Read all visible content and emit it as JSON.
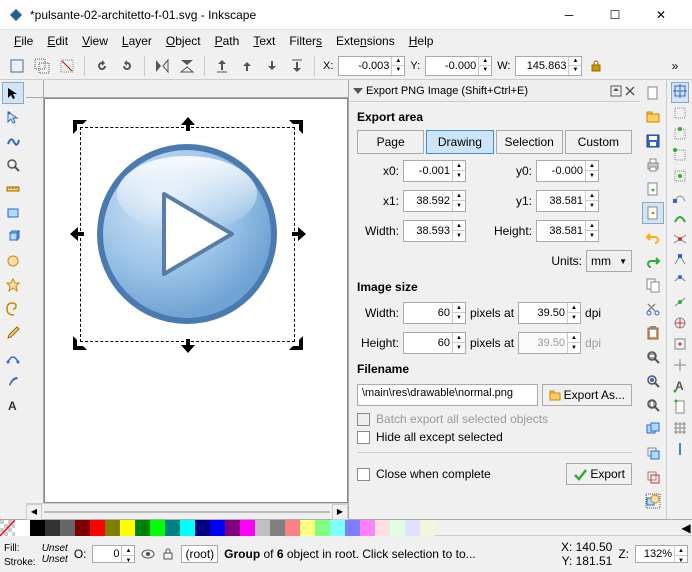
{
  "window": {
    "title": "*pulsante-02-architetto-f-01.svg - Inkscape"
  },
  "menu": {
    "file": "File",
    "edit": "Edit",
    "view": "View",
    "layer": "Layer",
    "object": "Object",
    "path": "Path",
    "text": "Text",
    "filters": "Filters",
    "extensions": "Extensions",
    "help": "Help"
  },
  "toolbar": {
    "x_label": "X:",
    "x_value": "-0.003",
    "y_label": "Y:",
    "y_value": "-0.000",
    "w_label": "W:",
    "w_value": "145.863"
  },
  "panel": {
    "title": "Export PNG Image (Shift+Ctrl+E)",
    "export_area": "Export area",
    "tab_page": "Page",
    "tab_drawing": "Drawing",
    "tab_selection": "Selection",
    "tab_custom": "Custom",
    "x0_label": "x0:",
    "x0_value": "-0.001",
    "y0_label": "y0:",
    "y0_value": "-0.000",
    "x1_label": "x1:",
    "x1_value": "38.592",
    "y1_label": "y1:",
    "y1_value": "38.581",
    "width_label": "Width:",
    "width_value": "38.593",
    "height_label": "Height:",
    "height_value": "38.581",
    "units_label": "Units:",
    "units_value": "mm",
    "image_size": "Image size",
    "iw_label": "Width:",
    "iw_value": "60",
    "pixels_at1": "pixels at",
    "dpi1_value": "39.50",
    "dpi_label": "dpi",
    "ih_label": "Height:",
    "ih_value": "60",
    "pixels_at2": "pixels at",
    "dpi2_value": "39.50",
    "filename_label": "Filename",
    "filepath": "\\main\\res\\drawable\\normal.png",
    "export_as": "Export As...",
    "batch_export": "Batch export all selected objects",
    "hide_all": "Hide all except selected",
    "close_when": "Close when complete",
    "export_btn": "Export"
  },
  "status": {
    "fill_label": "Fill:",
    "fill_value": "Unset",
    "stroke_label": "Stroke:",
    "stroke_value": "Unset",
    "o_label": "O:",
    "o_value": "0",
    "layer": "(root)",
    "msg": "Group of 6 object in root. Click selection to to...",
    "x_label": "X:",
    "x_value": "140.50",
    "y_label": "Y:",
    "y_value": "181.51",
    "z_label": "Z:",
    "z_value": "132%"
  },
  "palette_colors": [
    "#fff",
    "#000",
    "#333",
    "#666",
    "#800000",
    "#f00",
    "#808000",
    "#ff0",
    "#008000",
    "#0f0",
    "#008080",
    "#0ff",
    "#000080",
    "#00f",
    "#800080",
    "#f0f",
    "#c0c0c0",
    "#808080",
    "#ff8080",
    "#ffff80",
    "#80ff80",
    "#80ffff",
    "#8080ff",
    "#ff80ff",
    "#ffe0e0",
    "#e0ffe0",
    "#e0e0ff",
    "#f5f5dc"
  ]
}
